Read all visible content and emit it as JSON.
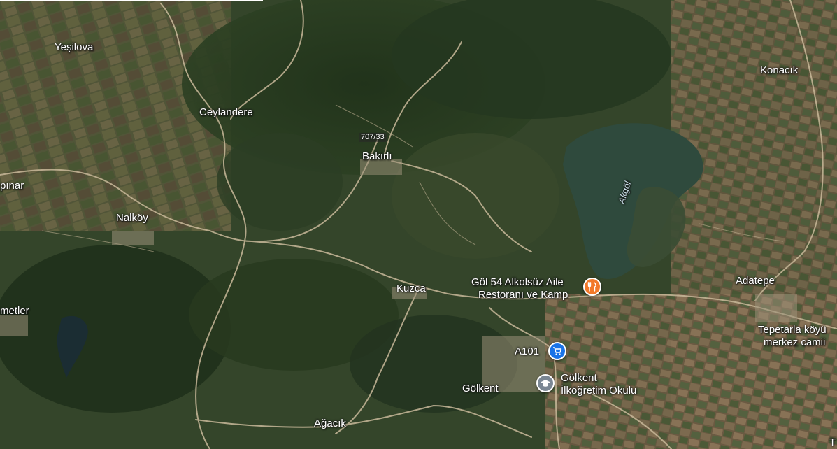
{
  "map": {
    "view": "satellite",
    "colors": {
      "restaurant": "#f2792a",
      "shopping": "#1a73e8",
      "school": "#7b8794",
      "lake": "#2e4a3b",
      "road": "#c9b99a"
    }
  },
  "places": {
    "yesilova": "Yeşilova",
    "ceylandere": "Ceylandere",
    "bakirli": "Bakırlı",
    "konacik": "Konacık",
    "pinar": "pınar",
    "nalkoy": "Nalköy",
    "kuzca": "Kuzca",
    "adatepe": "Adatepe",
    "metler": "metler",
    "golkent": "Gölkent",
    "agacik": "Ağacık",
    "tepetarla_line1": "Tepetarla köyü",
    "tepetarla_line2": "merkez camii",
    "edge_t": "T"
  },
  "road_shield": "707/33",
  "lake_label": "Akgöl",
  "pois": {
    "restaurant": {
      "line1": "Göl 54 Alkolsüz Aile",
      "line2": "Restoranı ve Kamp",
      "icon": "restaurant-icon"
    },
    "shop": {
      "name": "A101",
      "icon": "shopping-cart-icon"
    },
    "school": {
      "line1": "Gölkent",
      "line2": "İlköğretim Okulu",
      "icon": "graduation-cap-icon"
    }
  }
}
